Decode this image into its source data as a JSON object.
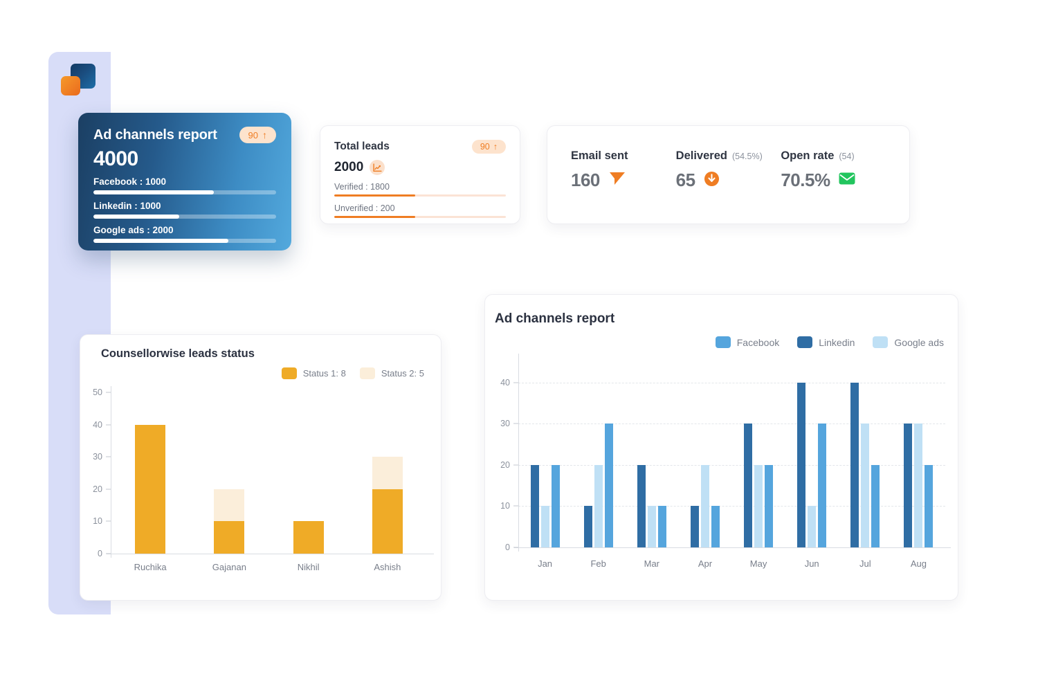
{
  "app": {
    "logo_name": "app-logo",
    "accent_orange": "#ef7d23",
    "accent_blue": "#3d8cc4",
    "sidebar_color": "#d8ddf8"
  },
  "ad_channels_card": {
    "title": "Ad channels report",
    "badge_value": "90",
    "badge_arrow": "↑",
    "total": "4000",
    "channels": [
      {
        "label": "Facebook : 1000",
        "percent": 66
      },
      {
        "label": "Linkedin : 1000",
        "percent": 47
      },
      {
        "label": "Google ads : 2000",
        "percent": 74
      }
    ]
  },
  "total_leads_card": {
    "title": "Total leads",
    "badge_value": "90",
    "badge_arrow": "↑",
    "value": "2000",
    "icon": "line-chart-icon",
    "rows": [
      {
        "label": "Verified : 1800",
        "percent": 47
      },
      {
        "label": "Unverified : 200",
        "percent": 47
      }
    ]
  },
  "email_card": {
    "metrics": [
      {
        "name": "Email sent",
        "sub": "",
        "value": "160",
        "icon": "paper-plane-icon",
        "icon_color": "#ef7d23"
      },
      {
        "name": "Delivered",
        "sub": "(54.5%)",
        "value": "65",
        "icon": "download-circle-icon",
        "icon_color": "#ef7d23"
      },
      {
        "name": "Open rate",
        "sub": "(54)",
        "value": "70.5%",
        "icon": "envelope-icon",
        "icon_color": "#22c55e"
      }
    ]
  },
  "chart_data": [
    {
      "id": "counsellorwise",
      "type": "bar",
      "title": "Counsellorwise leads status",
      "stacked": true,
      "categories": [
        "Ruchika",
        "Gajanan",
        "Nikhil",
        "Ashish"
      ],
      "series": [
        {
          "name": "Status 1: 8",
          "color": "#efab27",
          "values": [
            40,
            10,
            10,
            20
          ]
        },
        {
          "name": "Status 2: 5",
          "color": "#fbeeda",
          "values": [
            0,
            10,
            0,
            10
          ]
        }
      ],
      "ylim": [
        0,
        52
      ],
      "yticks": [
        0,
        10,
        20,
        30,
        40,
        50
      ],
      "xlabel": "",
      "ylabel": "",
      "grid": false,
      "legend_position": "top-right"
    },
    {
      "id": "ad-channels",
      "type": "bar",
      "title": "Ad channels report",
      "stacked": false,
      "categories": [
        "Jan",
        "Feb",
        "Mar",
        "Apr",
        "May",
        "Jun",
        "Jul",
        "Aug"
      ],
      "series": [
        {
          "name": "Facebook",
          "color": "#55a5dd",
          "values": [
            20,
            30,
            10,
            10,
            20,
            30,
            20,
            20
          ]
        },
        {
          "name": "Linkedin",
          "color": "#2f6da4",
          "values": [
            20,
            10,
            20,
            10,
            30,
            40,
            40,
            30
          ]
        },
        {
          "name": "Google ads",
          "color": "#bfe0f5",
          "values": [
            10,
            20,
            10,
            20,
            20,
            10,
            30,
            30
          ]
        }
      ],
      "draw_order": [
        "Linkedin",
        "Google ads",
        "Facebook"
      ],
      "ylim": [
        0,
        47
      ],
      "yticks": [
        0,
        10,
        20,
        30,
        40
      ],
      "xlabel": "",
      "ylabel": "",
      "grid": true,
      "legend_position": "top-right"
    }
  ]
}
